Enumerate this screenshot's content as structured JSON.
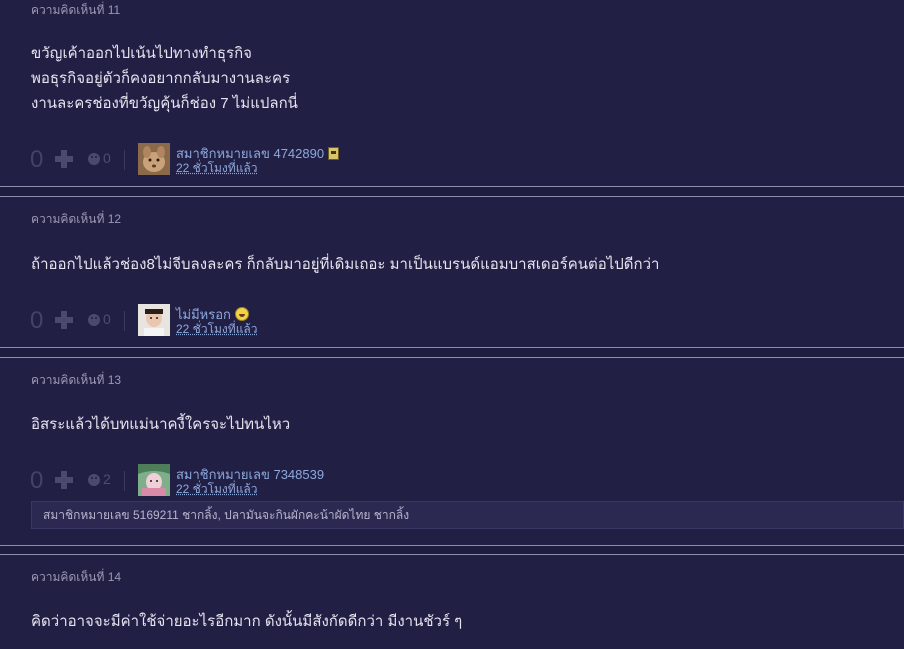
{
  "comments": [
    {
      "number": "ความคิดเห็นที่ 11",
      "lines": [
        "ขวัญเค้าออกไปเน้นไปทางทำธุรกิจ",
        "พอธุรกิจอยู่ตัวก็คงอยากกลับมางานละคร",
        "งานละครช่องที่ขวัญคุ้นก็ช่อง 7 ไม่แปลกนี่"
      ],
      "votes": "0",
      "emotions": "0",
      "username": "สมาชิกหมายเลข 4742890",
      "time": "22 ชั่วโมงที่แล้ว"
    },
    {
      "number": "ความคิดเห็นที่ 12",
      "lines": [
        "ถ้าออกไปแล้วช่อง8ไม่จีบลงละคร ก็กลับมาอยู่ที่เดิมเถอะ มาเป็นแบรนด์แอมบาสเดอร์คนต่อไปดีกว่า"
      ],
      "votes": "0",
      "emotions": "0",
      "username": "ไม่มีหรอก",
      "time": "22 ชั่วโมงที่แล้ว"
    },
    {
      "number": "ความคิดเห็นที่ 13",
      "lines": [
        "อิสระแล้วได้บทแม่นาคงี้ใครจะไปทนไหว"
      ],
      "votes": "0",
      "emotions": "2",
      "username": "สมาชิกหมายเลข 7348539",
      "time": "22 ชั่วโมงที่แล้ว",
      "reactions": "สมาชิกหมายเลข 5169211 ชากลิ้ง, ปลามันจะกินผักคะน้าผัดไทย ชากลิ้ง"
    },
    {
      "number": "ความคิดเห็นที่ 14",
      "lines": [
        "คิดว่าอาจจะมีค่าใช้จ่ายอะไรอีกมาก ดังนั้นมีสังกัดดีกว่า มีงานชัวร์ ๆ"
      ]
    }
  ]
}
